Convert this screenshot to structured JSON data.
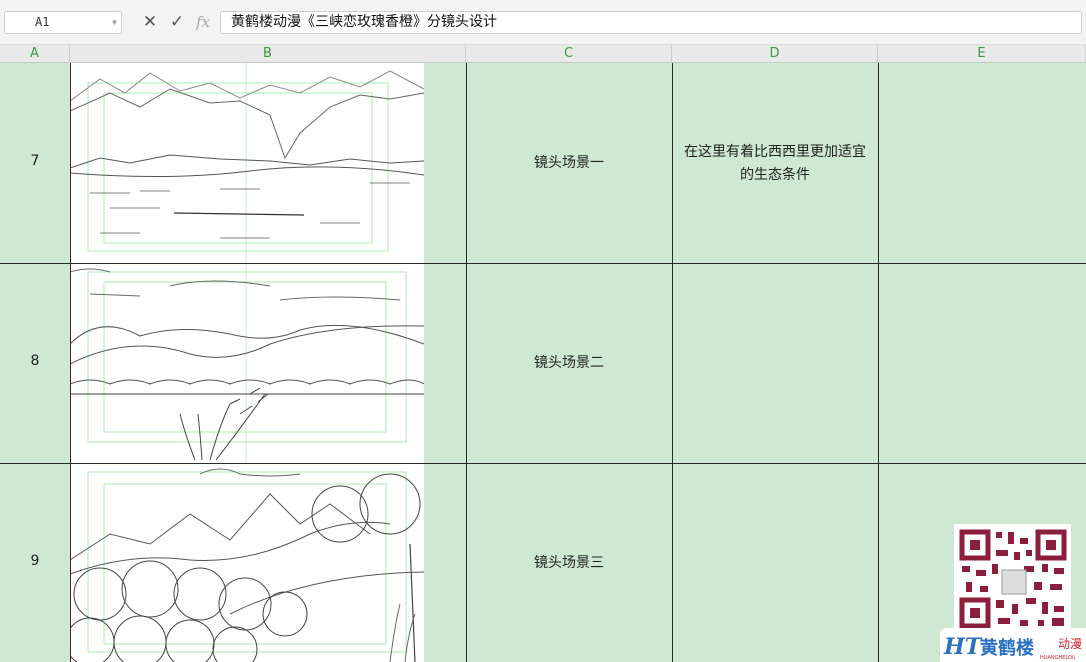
{
  "formula_bar": {
    "cell_ref": "A1",
    "formula": "黄鹤楼动漫《三峡恋玫瑰香橙》分镜头设计",
    "cancel_icon": "close-icon",
    "confirm_icon": "check-icon",
    "fx_label": "fx"
  },
  "columns": [
    "A",
    "B",
    "C",
    "D",
    "E"
  ],
  "rows": [
    {
      "num": "7",
      "scene": "镜头场景一",
      "desc_line1": "在这里有着比西西里更加适宜",
      "desc_line2": "的生态条件"
    },
    {
      "num": "8",
      "scene": "镜头场景二",
      "desc_line1": "",
      "desc_line2": ""
    },
    {
      "num": "9",
      "scene": "镜头场景三",
      "desc_line1": "",
      "desc_line2": ""
    }
  ],
  "logo": {
    "text": "黄鹤楼",
    "suffix": "动漫",
    "sub": "HUANGHELOU"
  },
  "colors": {
    "grid_bg": "#cfe8d2",
    "header_text": "#3a9a3a",
    "logo_blue": "#2a6fc2",
    "logo_red": "#c8242f",
    "qr_dark": "#8b1e3a"
  }
}
